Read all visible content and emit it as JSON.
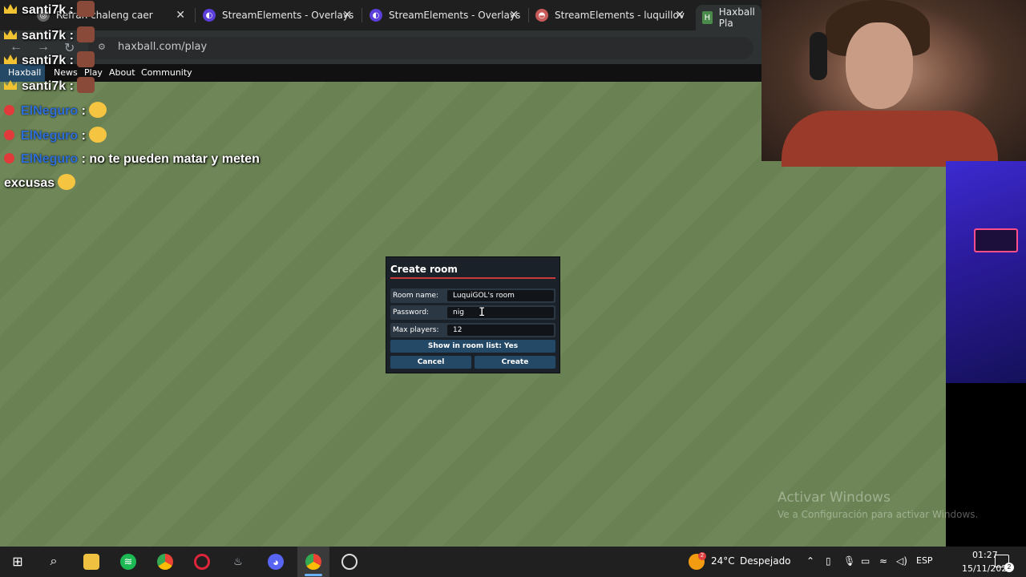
{
  "browser": {
    "tabs": [
      {
        "title": "Refrán chaleng caer",
        "icon": "globe-icon",
        "color": "#888888"
      },
      {
        "title": "StreamElements - Overlays",
        "icon": "streamelements-icon",
        "color": "#5b3fd8"
      },
      {
        "title": "StreamElements - Overlays",
        "icon": "streamelements-icon",
        "color": "#5b3fd8"
      },
      {
        "title": "StreamElements - luquillov",
        "icon": "streamelements-icon",
        "color": "#c75a5a"
      },
      {
        "title": "Haxball Pla",
        "icon": "haxball-icon",
        "color": "#4a8a4a"
      }
    ],
    "url": "haxball.com/play"
  },
  "site_nav": {
    "items": [
      "Haxball",
      "News",
      "Play",
      "About",
      "Community"
    ]
  },
  "chat": [
    {
      "user": "santi7k",
      "message": "",
      "style": "yellow",
      "emote": "face"
    },
    {
      "user": "santi7k",
      "message": "",
      "style": "yellow",
      "emote": "face"
    },
    {
      "user": "santi7k",
      "message": "",
      "style": "yellow",
      "emote": "face"
    },
    {
      "user": "ElNeguro",
      "message": "",
      "style": "blue",
      "emote": "duck"
    },
    {
      "user": "ElNeguro",
      "message": "",
      "style": "blue",
      "emote": "duck"
    },
    {
      "user": "ElNeguro",
      "message": "no te pueden matar y meten",
      "style": "blue",
      "emote": ""
    },
    {
      "user": "",
      "message": "excusas",
      "style": "cont",
      "emote": "duck"
    }
  ],
  "dialog": {
    "title": "Create room",
    "room_name_label": "Room name:",
    "room_name_value": "LuquiGOL's room",
    "password_label": "Password:",
    "password_value": "nig",
    "max_players_label": "Max players:",
    "max_players_value": "12",
    "show_in_list": "Show in room list: Yes",
    "cancel": "Cancel",
    "create": "Create"
  },
  "watermark": {
    "line1": "Activar Windows",
    "line2": "Ve a Configuración para activar Windows."
  },
  "taskbar": {
    "weather_temp": "24°C",
    "weather_desc": "Despejado",
    "weather_badge": "2",
    "lang": "ESP",
    "time": "01:27",
    "date": "15/11/2025",
    "notif_count": "2"
  },
  "colors": {
    "accent_button": "#244967",
    "dialog_bg": "#1a2128",
    "title_line": "#c73b3b",
    "field_green": "#6f8758"
  }
}
